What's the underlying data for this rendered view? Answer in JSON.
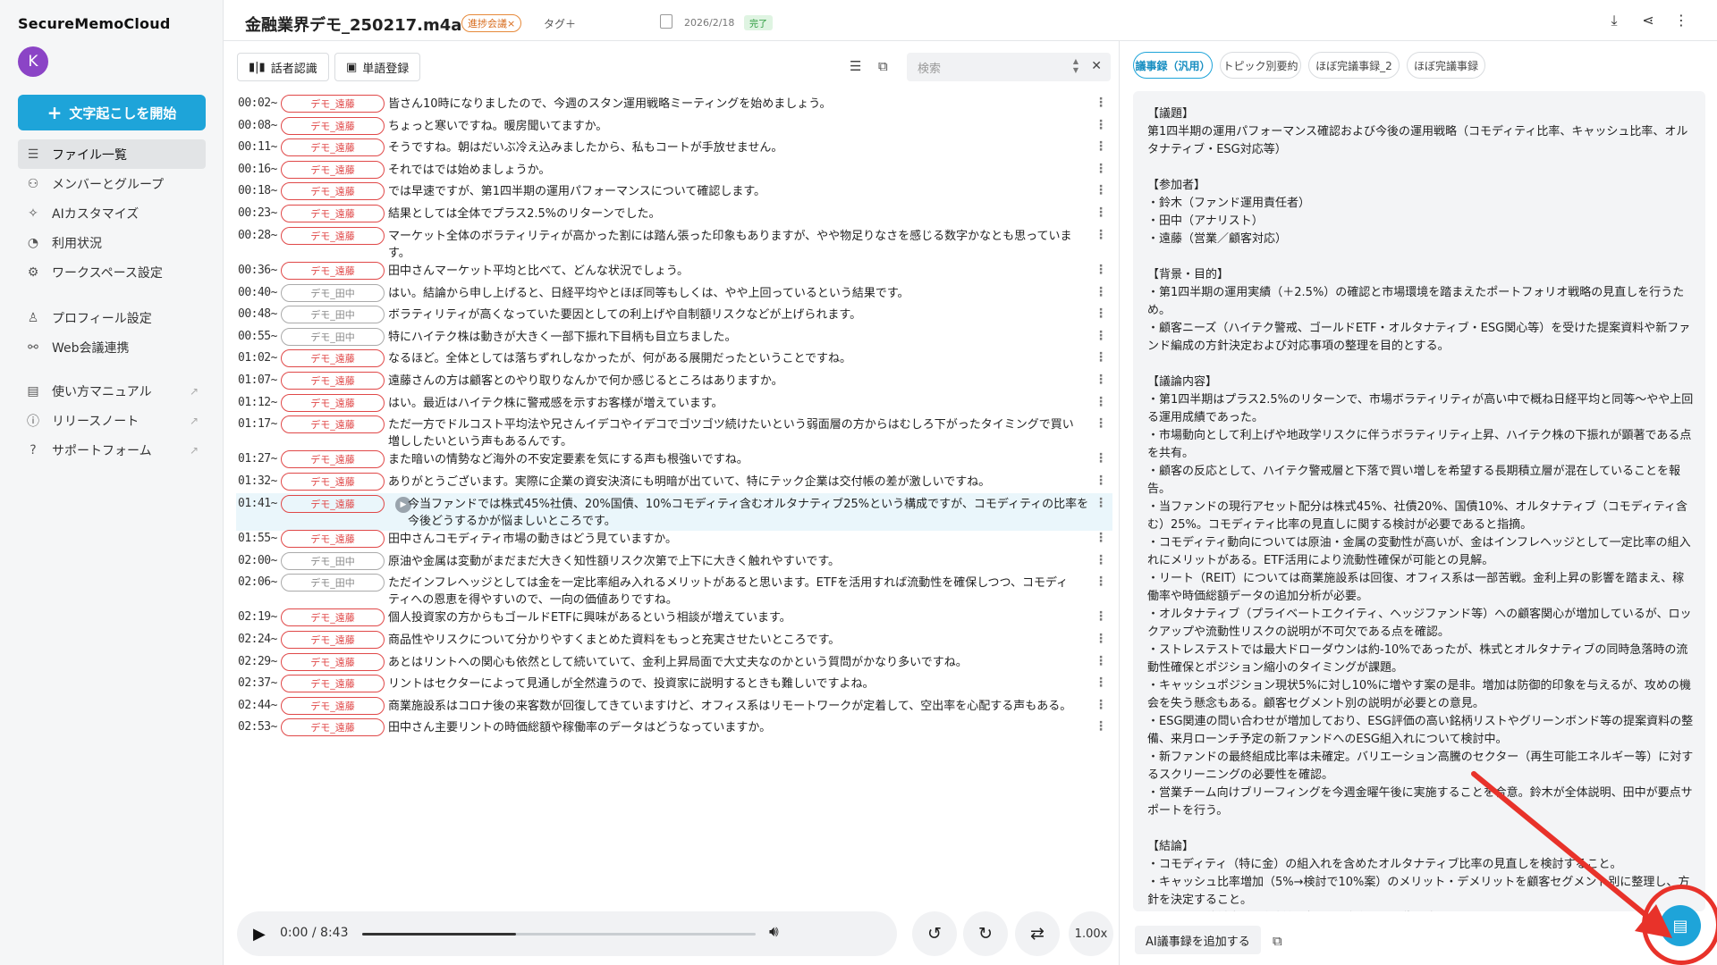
{
  "app": {
    "brand": "SecureMemoCloud",
    "avatar_letter": "K",
    "start_button": "文字起こしを開始"
  },
  "sidebar": {
    "group1": [
      {
        "label": "ファイル一覧",
        "icon": "list-icon",
        "active": true
      },
      {
        "label": "メンバーとグループ",
        "icon": "users-icon"
      },
      {
        "label": "AIカスタマイズ",
        "icon": "sparkle-icon"
      },
      {
        "label": "利用状況",
        "icon": "chart-icon"
      },
      {
        "label": "ワークスペース設定",
        "icon": "gear-icon"
      }
    ],
    "group2": [
      {
        "label": "プロフィール設定",
        "icon": "person-icon"
      },
      {
        "label": "Web会議連携",
        "icon": "link-icon"
      }
    ],
    "group3": [
      {
        "label": "使い方マニュアル",
        "icon": "book-icon"
      },
      {
        "label": "リリースノート",
        "icon": "info-icon"
      },
      {
        "label": "サポートフォーム",
        "icon": "help-icon"
      }
    ]
  },
  "header": {
    "file_title": "金融業界デモ_250217.m4a",
    "tag": "進捗会議×",
    "tag_add": "タグ＋",
    "date": "2026/2/18",
    "status": "完了"
  },
  "toolbar": {
    "speaker_recognition": "話者認識",
    "word_register": "単語登録",
    "search_placeholder": "検索"
  },
  "transcript": [
    {
      "time": "00:02~",
      "speaker": "デモ_遠藤",
      "type": "red",
      "text": "皆さん10時になりましたので、今週のスタン運用戦略ミーティングを始めましょう。"
    },
    {
      "time": "00:08~",
      "speaker": "デモ_遠藤",
      "type": "red",
      "text": "ちょっと寒いですね。暖房聞いてますか。"
    },
    {
      "time": "00:11~",
      "speaker": "デモ_遠藤",
      "type": "red",
      "text": "そうですね。朝はだいぶ冷え込みましたから、私もコートが手放せません。"
    },
    {
      "time": "00:16~",
      "speaker": "デモ_遠藤",
      "type": "red",
      "text": "それではでは始めましょうか。"
    },
    {
      "time": "00:18~",
      "speaker": "デモ_遠藤",
      "type": "red",
      "text": "では早速ですが、第1四半期の運用パフォーマンスについて確認します。"
    },
    {
      "time": "00:23~",
      "speaker": "デモ_遠藤",
      "type": "red",
      "text": "結果としては全体でプラス2.5%のリターンでした。"
    },
    {
      "time": "00:28~",
      "speaker": "デモ_遠藤",
      "type": "red",
      "text": "マーケット全体のボラティリティが高かった割には踏ん張った印象もありますが、やや物足りなさを感じる数字かなとも思っています。"
    },
    {
      "time": "00:36~",
      "speaker": "デモ_遠藤",
      "type": "red",
      "text": "田中さんマーケット平均と比べて、どんな状況でしょう。"
    },
    {
      "time": "00:40~",
      "speaker": "デモ_田中",
      "type": "gray",
      "text": "はい。結論から申し上げると、日経平均やとほぼ同等もしくは、やや上回っているという結果です。"
    },
    {
      "time": "00:48~",
      "speaker": "デモ_田中",
      "type": "gray",
      "text": "ボラティリティが高くなっていた要因としての利上げや自制額リスクなどが上げられます。"
    },
    {
      "time": "00:55~",
      "speaker": "デモ_田中",
      "type": "gray",
      "text": "特にハイテク株は動きが大きく一部下振れ下目柄も目立ちました。"
    },
    {
      "time": "01:02~",
      "speaker": "デモ_遠藤",
      "type": "red",
      "text": "なるほど。全体としては落ちずれしなかったが、何がある展開だったということですね。"
    },
    {
      "time": "01:07~",
      "speaker": "デモ_遠藤",
      "type": "red",
      "text": "遠藤さんの方は顧客とのやり取りなんかで何か感じるところはありますか。"
    },
    {
      "time": "01:12~",
      "speaker": "デモ_遠藤",
      "type": "red",
      "text": "はい。最近はハイテク株に警戒感を示すお客様が増えています。"
    },
    {
      "time": "01:17~",
      "speaker": "デモ_遠藤",
      "type": "red",
      "text": "ただ一方でドルコスト平均法や兄さんイデコやイデコでゴツゴツ続けたいという弱面層の方からはむしろ下がったタイミングで買い増ししたいという声もあるんです。"
    },
    {
      "time": "01:27~",
      "speaker": "デモ_遠藤",
      "type": "red",
      "text": "また暗いの情勢など海外の不安定要素を気にする声も根強いですね。"
    },
    {
      "time": "01:32~",
      "speaker": "デモ_遠藤",
      "type": "red",
      "text": "ありがとうございます。実際に企業の資安決済にも明暗が出ていて、特にテック企業は交付帳の差が激しいですね。"
    },
    {
      "time": "01:41~",
      "speaker": "デモ_遠藤",
      "type": "red",
      "text": "今当ファンドでは株式45%社債、20%国債、10%コモディティ含むオルタナティブ25%という構成ですが、コモディティの比率を今後どうするかが悩ましいところです。",
      "highlight": true
    },
    {
      "time": "01:55~",
      "speaker": "デモ_遠藤",
      "type": "red",
      "text": "田中さんコモディティ市場の動きはどう見ていますか。"
    },
    {
      "time": "02:00~",
      "speaker": "デモ_田中",
      "type": "gray",
      "text": "原油や金属は変動がまだまだ大きく知性額リスク次第で上下に大きく触れやすいです。"
    },
    {
      "time": "02:06~",
      "speaker": "デモ_田中",
      "type": "gray",
      "text": "ただインフレヘッジとしては金を一定比率組み入れるメリットがあると思います。ETFを活用すれば流動性を確保しつつ、コモディティへの恩恵を得やすいので、一向の価値ありですね。"
    },
    {
      "time": "02:19~",
      "speaker": "デモ_遠藤",
      "type": "red",
      "text": "個人投資家の方からもゴールドETFに興味があるという相談が増えています。"
    },
    {
      "time": "02:24~",
      "speaker": "デモ_遠藤",
      "type": "red",
      "text": "商品性やリスクについて分かりやすくまとめた資料をもっと充実させたいところです。"
    },
    {
      "time": "02:29~",
      "speaker": "デモ_遠藤",
      "type": "red",
      "text": "あとはリントへの関心も依然として続いていて、金利上昇局面で大丈夫なのかという質問がかなり多いですね。"
    },
    {
      "time": "02:37~",
      "speaker": "デモ_遠藤",
      "type": "red",
      "text": "リントはセクターによって見通しが全然違うので、投資家に説明するときも難しいですよね。"
    },
    {
      "time": "02:44~",
      "speaker": "デモ_遠藤",
      "type": "red",
      "text": "商業施設系はコロナ後の来客数が回復してきていますけど、オフィス系はリモートワークが定着して、空出率を心配する声もある。"
    },
    {
      "time": "02:53~",
      "speaker": "デモ_遠藤",
      "type": "red",
      "text": "田中さん主要リントの時価総額や稼働率のデータはどうなっていますか。"
    }
  ],
  "player": {
    "time": "0:00 / 8:43",
    "progress_percent": 39,
    "speed": "1.00x"
  },
  "minutes": {
    "tabs": [
      "議事録（汎用）",
      "トピック別要約",
      "ほぼ完議事録_2",
      "ほぼ完議事録"
    ],
    "body": "【議題】\n第1四半期の運用パフォーマンス確認および今後の運用戦略（コモディティ比率、キャッシュ比率、オルタナティブ・ESG対応等）\n\n【参加者】\n・鈴木（ファンド運用責任者）\n・田中（アナリスト）\n・遠藤（営業／顧客対応）\n\n【背景・目的】\n・第1四半期の運用実績（＋2.5%）の確認と市場環境を踏まえたポートフォリオ戦略の見直しを行うため。\n・顧客ニーズ（ハイテク警戒、ゴールドETF・オルタナティブ・ESG関心等）を受けた提案資料や新ファンド編成の方針決定および対応事項の整理を目的とする。\n\n【議論内容】\n・第1四半期はプラス2.5%のリターンで、市場ボラティリティが高い中で概ね日経平均と同等〜やや上回る運用成績であった。\n・市場動向として利上げや地政学リスクに伴うボラティリティ上昇、ハイテク株の下振れが顕著である点を共有。\n・顧客の反応として、ハイテク警戒層と下落で買い増しを希望する長期積立層が混在していることを報告。\n・当ファンドの現行アセット配分は株式45%、社債20%、国債10%、オルタナティブ（コモディティ含む）25%。コモディティ比率の見直しに関する検討が必要であると指摘。\n・コモディティ動向については原油・金属の変動性が高いが、金はインフレヘッジとして一定比率の組入れにメリットがある。ETF活用により流動性確保が可能との見解。\n・リート（REIT）については商業施設系は回復、オフィス系は一部苦戦。金利上昇の影響を踏まえ、稼働率や時価総額データの追加分析が必要。\n・オルタナティブ（プライベートエクイティ、ヘッジファンド等）への顧客関心が増加しているが、ロックアップや流動性リスクの説明が不可欠である点を確認。\n・ストレステストでは最大ドローダウンは約-10%であったが、株式とオルタナティブの同時急落時の流動性確保とポジション縮小のタイミングが課題。\n・キャッシュポジション現状5%に対し10%に増やす案の是非。増加は防御的印象を与えるが、攻めの機会を失う懸念もある。顧客セグメント別の説明が必要との意見。\n・ESG関連の問い合わせが増加しており、ESG評価の高い銘柄リストやグリーンボンド等の提案資料の整備、来月ローンチ予定の新ファンドへのESG組入れについて検討中。\n・新ファンドの最終組成比率は未確定。バリエーション高騰のセクター（再生可能エネルギー等）に対するスクリーニングの必要性を確認。\n・営業チーム向けブリーフィングを今週金曜午後に実施することを合意。鈴木が全体説明、田中が要点サポートを行う。\n\n【結論】\n・コモディティ（特に金）の組入れを含めたオルタナティブ比率の見直しを検討すること。\n・キャッシュ比率増加（5%→検討で10%案）のメリット・デメリットを顧客セグメント別に整理し、方針を決定すること。\n・リートの稼働率・時価総額データ、金利上昇影響を次回までに取りまとめること。",
    "ai_button": "AI議事録を追加する"
  },
  "colors": {
    "accent": "#1ea4d9",
    "speaker_red": "#e04848",
    "annotation": "#e8322a"
  }
}
